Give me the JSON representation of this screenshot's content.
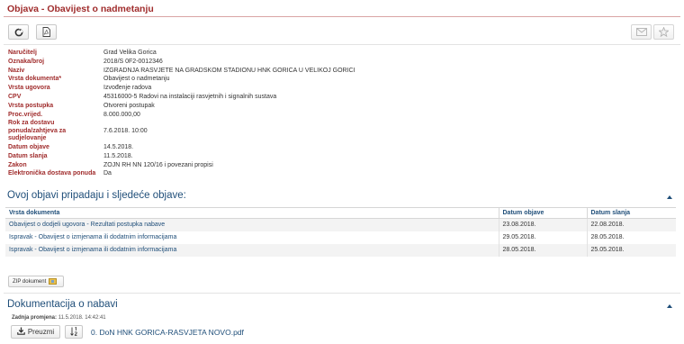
{
  "page": {
    "title": "Objava - Obavijest o nadmetanju"
  },
  "toolbar": {
    "left_icons": [
      "refresh-icon",
      "pdf-icon"
    ],
    "right_icons": [
      "envelope-icon",
      "star-icon"
    ]
  },
  "details": [
    {
      "label": "Naručitelj",
      "value": "Grad Velika Gorica"
    },
    {
      "label": "Oznaka/broj",
      "value": "2018/S 0F2-0012346"
    },
    {
      "label": "Naziv",
      "value": "IZGRADNJA RASVJETE NA GRADSKOM STADIONU HNK GORICA U VELIKOJ GORICI"
    },
    {
      "label": "Vrsta dokumenta*",
      "value": "Obavijest o nadmetanju"
    },
    {
      "label": "Vrsta ugovora",
      "value": "Izvođenje radova"
    },
    {
      "label": "CPV",
      "value": "45316000-5 Radovi na instalaciji rasvjetnih i signalnih sustava"
    },
    {
      "label": "Vrsta postupka",
      "value": "Otvoreni postupak"
    },
    {
      "label": "Proc.vrijed.",
      "value": "8.000.000,00"
    },
    {
      "label": "Rok za dostavu ponuda/zahtjeva za sudjelovanje",
      "value": "7.6.2018. 10:00"
    },
    {
      "label": "Datum objave",
      "value": "14.5.2018."
    },
    {
      "label": "Datum slanja",
      "value": "11.5.2018."
    },
    {
      "label": "Zakon",
      "value": "ZOJN RH NN 120/16 i povezani propisi"
    },
    {
      "label": "Elektronička dostava ponuda",
      "value": "Da"
    }
  ],
  "related": {
    "title": "Ovoj objavi pripadaju i sljedeće objave:",
    "columns": [
      "Vrsta dokumenta",
      "Datum objave",
      "Datum slanja"
    ],
    "rows": [
      {
        "type": "Obavijest o dodjeli ugovora - Rezultati postupka nabave",
        "published": "23.08.2018.",
        "sent": "22.08.2018."
      },
      {
        "type": "Ispravak - Obavijest o izmjenama ili dodatnim informacijama",
        "published": "29.05.2018.",
        "sent": "28.05.2018."
      },
      {
        "type": "Ispravak - Obavijest o izmjenama ili dodatnim informacijama",
        "published": "28.05.2018.",
        "sent": "25.05.2018."
      }
    ]
  },
  "zip": {
    "label": "ZIP dokument"
  },
  "docs": {
    "title": "Dokumentacija o nabavi",
    "last_change_label": "Zadnja promjena:",
    "last_change_value": "11.5.2018. 14:42:41",
    "download_label": "Preuzmi",
    "file_name": "0. DoN HNK GORICA-RASVJETA NOVO.pdf"
  },
  "colors": {
    "brand_red": "#a02c2c",
    "link_blue": "#1f4e79"
  }
}
